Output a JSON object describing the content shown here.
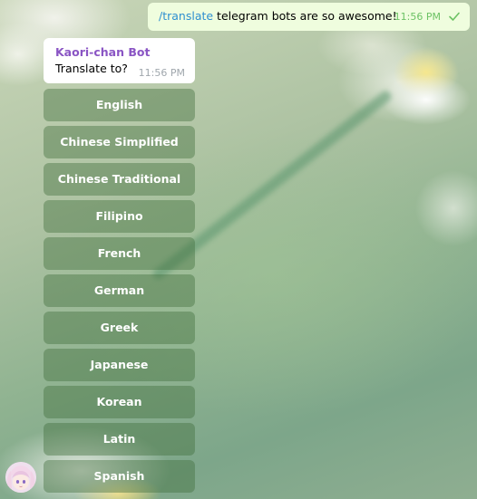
{
  "outgoing_message": {
    "command": "/translate",
    "text": " telegram bots are so awesome!",
    "time": "11:56 PM",
    "status_icon": "check-icon"
  },
  "bot_message": {
    "sender": "Kaori-chan Bot",
    "text": "Translate to?",
    "time": "11:56 PM"
  },
  "keyboard": {
    "buttons": [
      "English",
      "Chinese Simplified",
      "Chinese Traditional",
      "Filipino",
      "French",
      "German",
      "Greek",
      "Japanese",
      "Korean",
      "Latin",
      "Spanish"
    ]
  },
  "colors": {
    "command_link": "#2f8fd0",
    "sender_name": "#8a55c4",
    "outgoing_time": "#6cc264",
    "outgoing_bubble": "#effdde",
    "button_fill": "rgba(65,110,60,0.42)"
  }
}
